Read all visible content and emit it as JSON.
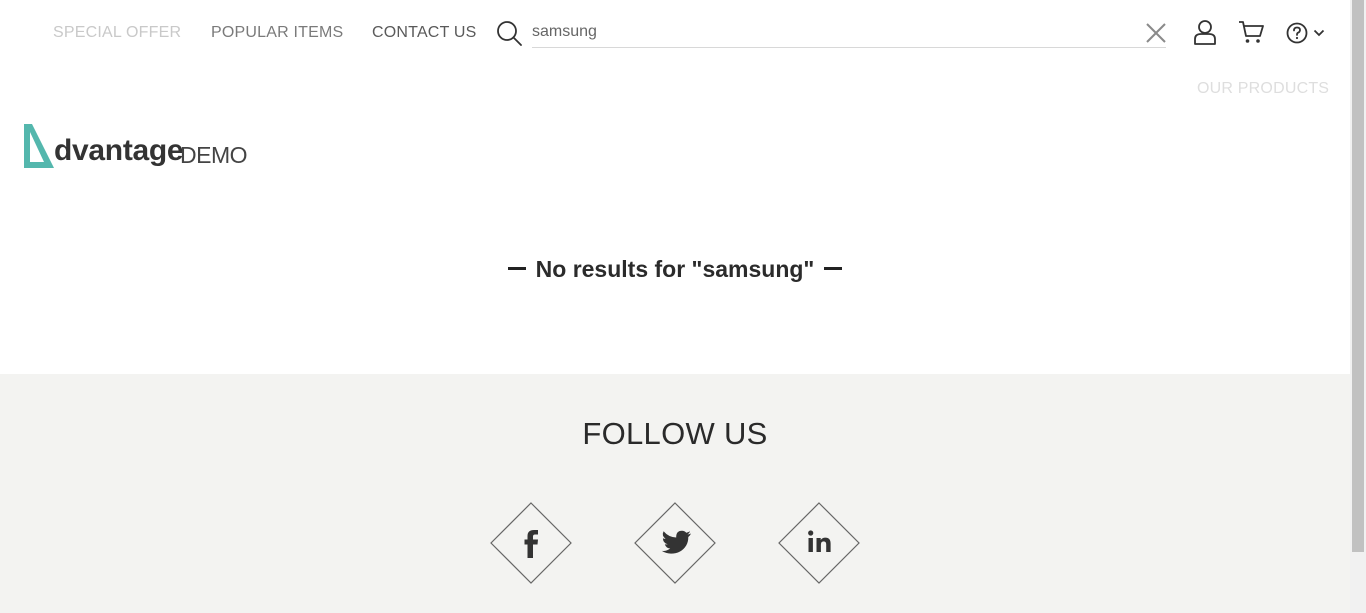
{
  "nav": {
    "special_offer": "SPECIAL OFFER",
    "popular_items": "POPULAR ITEMS",
    "contact_us": "CONTACT US",
    "our_products": "OUR PRODUCTS"
  },
  "search": {
    "value": "samsung",
    "placeholder": ""
  },
  "icons": [
    "search-icon",
    "close-icon",
    "user-icon",
    "cart-icon",
    "help-icon",
    "chevron-down-icon",
    "facebook-icon",
    "twitter-icon",
    "linkedin-icon"
  ],
  "logo": {
    "name": "dvantage",
    "suffix": "DEMO"
  },
  "results": {
    "message": "No results for \"samsung\""
  },
  "footer": {
    "follow_us": "FOLLOW US"
  },
  "colors": {
    "brand_teal": "#54b7ad",
    "footer_bg": "#f3f3f1"
  }
}
